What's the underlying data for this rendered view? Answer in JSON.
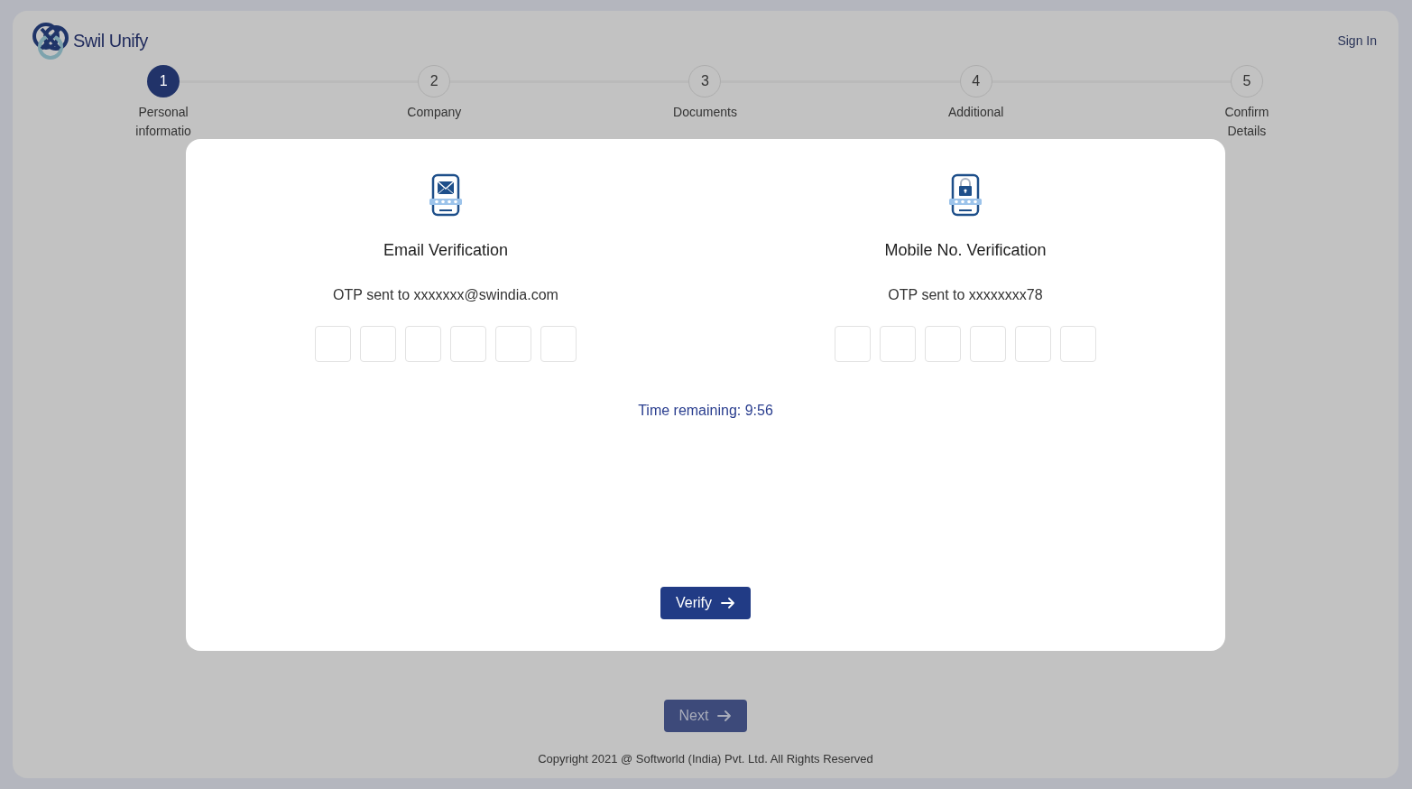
{
  "brand": {
    "name": "Swil Unify"
  },
  "header": {
    "sign_in": "Sign In"
  },
  "steps": [
    {
      "number": "1",
      "label_lines": [
        "Personal",
        "informatio"
      ],
      "selected": true
    },
    {
      "number": "2",
      "label_lines": [
        "Company"
      ],
      "selected": false
    },
    {
      "number": "3",
      "label_lines": [
        "Documents"
      ],
      "selected": false
    },
    {
      "number": "4",
      "label_lines": [
        "Additional"
      ],
      "selected": false
    },
    {
      "number": "5",
      "label_lines": [
        "Confirm",
        "Details"
      ],
      "selected": false
    }
  ],
  "modal": {
    "sections": [
      {
        "kind": "email",
        "title": "Email Verification",
        "sent_to": "OTP sent to xxxxxxx@swindia.com",
        "digits": [
          {
            "filled": false
          },
          {
            "filled": false
          },
          {
            "filled": false
          },
          {
            "filled": false
          },
          {
            "filled": false
          },
          {
            "filled": false
          }
        ]
      },
      {
        "kind": "mobile",
        "title": "Mobile No. Verification",
        "sent_to": "OTP sent to xxxxxxxx78",
        "digits": [
          {
            "filled": false
          },
          {
            "filled": false
          },
          {
            "filled": false
          },
          {
            "filled": false
          },
          {
            "filled": false
          },
          {
            "filled": false
          }
        ]
      }
    ],
    "timer": "Time remaining: 9:56",
    "verify": "Verify"
  },
  "next": {
    "label": "Next",
    "disabled": true
  },
  "footer": "Copyright 2021 @ Softworld (India) Pvt. Ltd. All Rights Reserved"
}
